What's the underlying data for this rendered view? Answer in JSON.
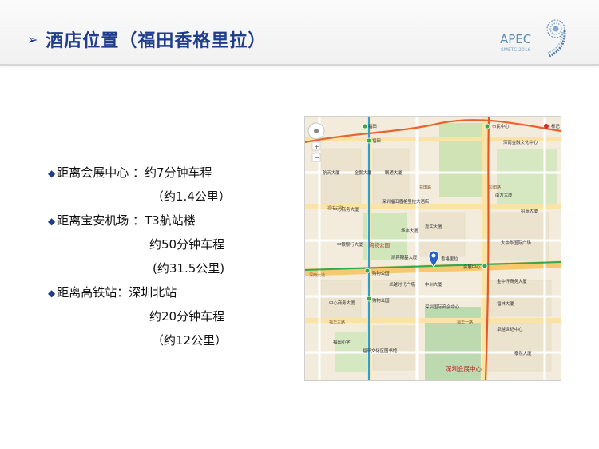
{
  "header": {
    "title": "酒店位置（福田香格里拉）",
    "arrow_icon": "arrow-right-icon",
    "logo": {
      "text": "APEC",
      "subtitle": "SMETC 2016",
      "number": "9"
    }
  },
  "content": {
    "lines": [
      {
        "bullet": "◆",
        "text": "距离会展中心 ：约7分钟车程"
      },
      {
        "bullet": "",
        "text": "（约1.4公里）"
      },
      {
        "bullet": "◆",
        "text": "距离宝安机场 ：T3航站楼"
      },
      {
        "bullet": "",
        "text": "约50分钟车程"
      },
      {
        "bullet": "",
        "text": "(约31.5公里)"
      },
      {
        "bullet": "◆",
        "text": "距离高铁站：深圳北站"
      },
      {
        "bullet": "",
        "text": "约20分钟车程"
      },
      {
        "bullet": "",
        "text": "（约12公里）"
      }
    ]
  },
  "map": {
    "marker_label": "香格里拉",
    "zoom_control_label": "标记",
    "places": {
      "futian": "福田",
      "futian2": "福田",
      "shiminzhongxin": "市民中心",
      "shenzhen_cbd": "深南金融文化中心",
      "hangtian": "航天大厦",
      "jinge": "金鹅大厦",
      "lianhe": "联通大厦",
      "zhongxin_shangwu": "中心商务大厦",
      "shenzhen_futian": "深圳福田香格里拉大酒店",
      "jiashi": "嘉实大厦",
      "huafeng": "华丰大厦",
      "zhongyin": "中银银行大厦",
      "gouwu_gongyuan": "购物公园",
      "gouwu_gongyuan2": "购物公园",
      "gouwu_gongyuan3": "购物公园",
      "kaibin": "凯宾斯基大厦",
      "zhuoyue": "卓越时代广场",
      "shenzhen_guoji": "深圳国际商会中心",
      "huizhan": "会展中心",
      "shenzhen_huizhan": "深圳会展中心",
      "zhongzhou": "中洲大厦",
      "futian_xiaoxue": "福田小学",
      "futian_wenhua": "福田文化区图书馆",
      "jinzhonghuan": "金中环商务大厦",
      "fulin": "福林大厦",
      "zhaoshang": "招商大厦",
      "zhuoyue2": "卓越世纪中心",
      "tairan": "泰然大厦",
      "nanfang": "南方大厦",
      "zhongxin2": "中心商务大厦",
      "dayu": "大中华国际广场",
      "futian_road": "福华三路",
      "fuhua1": "福华一路",
      "shennan": "深南大道",
      "yitian": "益田路",
      "caitian": "彩田路",
      "fuzhong": "福中三路"
    }
  }
}
